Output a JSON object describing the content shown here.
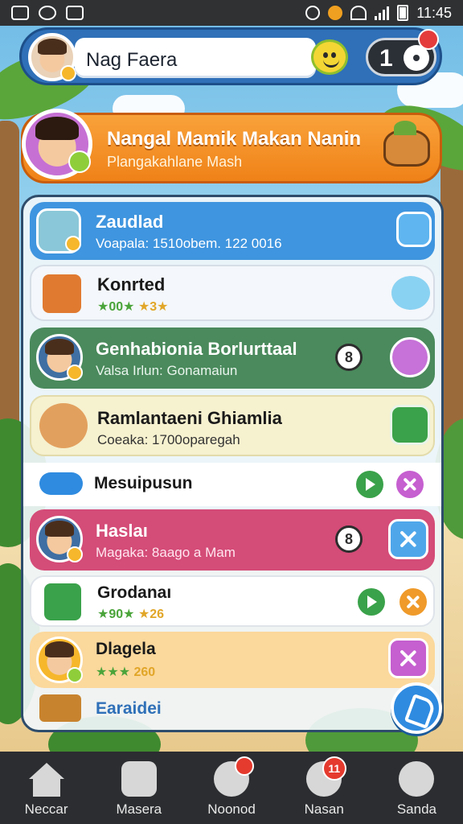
{
  "status_bar": {
    "time": "11:45"
  },
  "header": {
    "player_name": "Nag Faera",
    "counter": "1"
  },
  "banner": {
    "title": "Nangal Mamik Makan Nanin",
    "subtitle": "Plangakahlane Mash"
  },
  "list": [
    {
      "title": "Zaudlad",
      "subtitle": "Voapala: 1510obem. 122 0016",
      "color": "#3f95df"
    },
    {
      "title": "Konrted",
      "rating": "★00★",
      "rating2": "★3★",
      "color": "#f4f7fb"
    },
    {
      "title": "Genhabionia Borlurttaal",
      "subtitle": "Valsa Irlun: Gonamaiun",
      "badge": "8",
      "color": "#4a8a5c"
    },
    {
      "title": "Ramlantaeni Ghiamlia",
      "subtitle": "Coeaka: 1700oparegah",
      "color": "#f6f1cf"
    },
    {
      "title": "Mesuipusun",
      "color": "#ffffff"
    },
    {
      "title": "Haslaı",
      "subtitle": "Magaka: 8aago a Mam",
      "badge": "8",
      "color": "#d44c78"
    },
    {
      "title": "Grodanaı",
      "rating": "★90★",
      "rating2": "★26",
      "color": "#ffffff"
    },
    {
      "title": "Dlagela",
      "rating": "★★★",
      "rating2": "260",
      "color": "#fbd89c"
    },
    {
      "title": "Earaidei",
      "color": "#eef2f6"
    }
  ],
  "bottom_nav": [
    {
      "label": "Neccar",
      "icon": "home-icon"
    },
    {
      "label": "Masera",
      "icon": "shop-icon"
    },
    {
      "label": "Noonod",
      "icon": "friends-icon"
    },
    {
      "label": "Nasan",
      "icon": "chat-icon",
      "badge": "11"
    },
    {
      "label": "Sanda",
      "icon": "settings-icon"
    }
  ]
}
